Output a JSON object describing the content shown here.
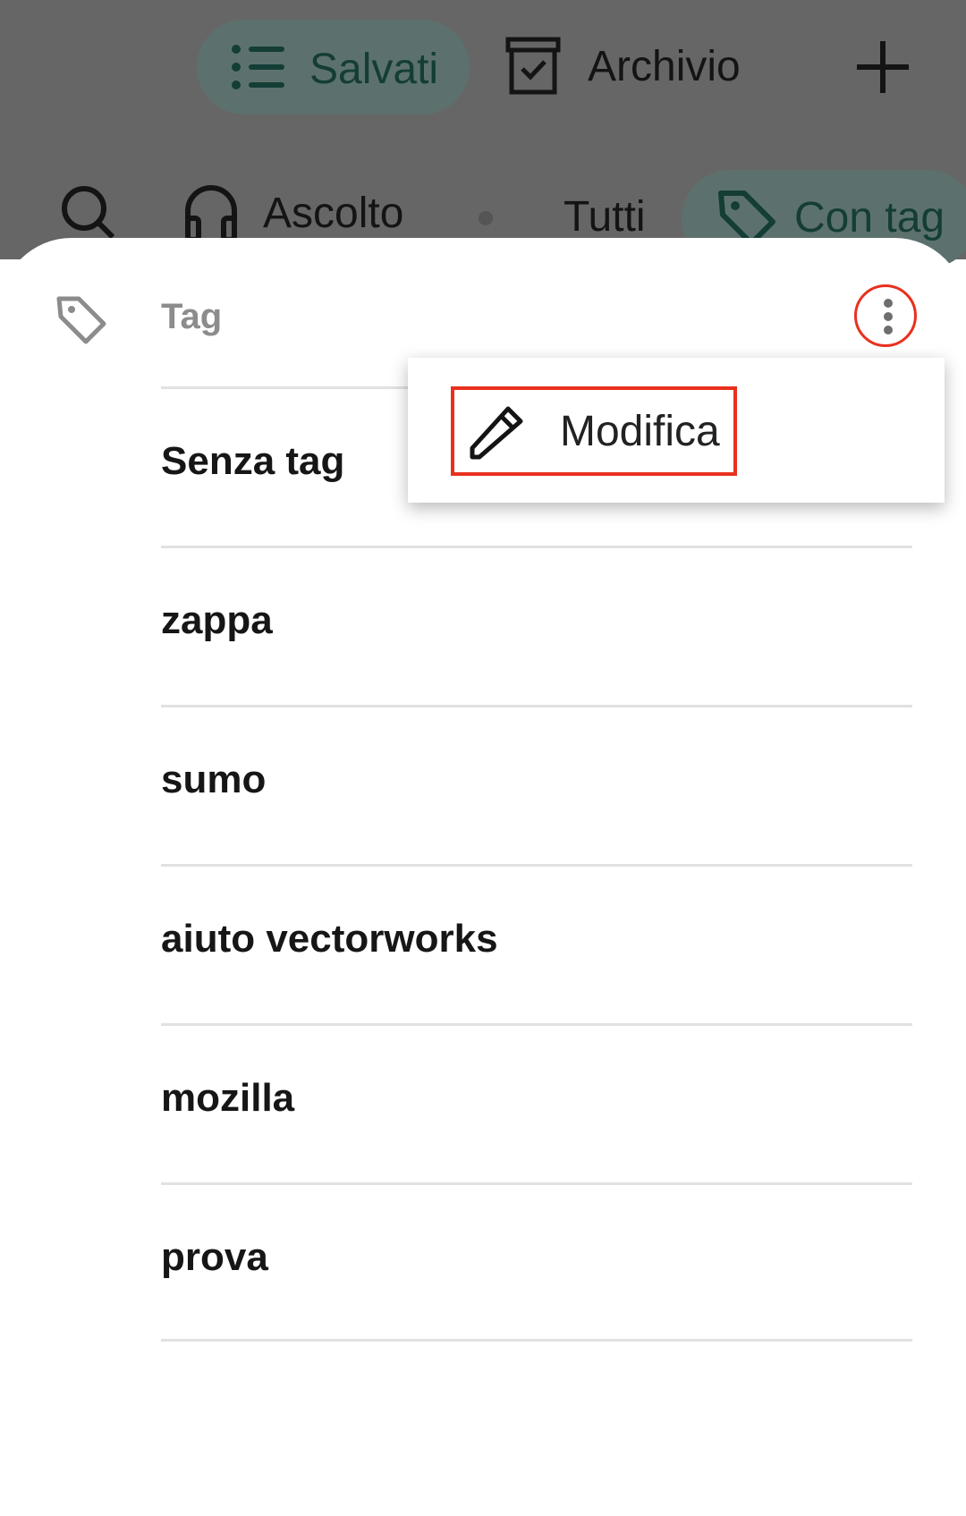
{
  "top_nav": {
    "saved_label": "Salvati",
    "archive_label": "Archivio"
  },
  "filters": {
    "listen_label": "Ascolto",
    "all_label": "Tutti",
    "tagged_label": "Con tag"
  },
  "sheet": {
    "title": "Tag",
    "items": [
      {
        "label": "Senza tag"
      },
      {
        "label": "zappa"
      },
      {
        "label": "sumo"
      },
      {
        "label": "aiuto vectorworks"
      },
      {
        "label": "mozilla"
      },
      {
        "label": "prova"
      }
    ]
  },
  "menu": {
    "edit_label": "Modifica"
  },
  "colors": {
    "accent": "#1f5a50",
    "highlight": "#e8311e",
    "scrim": "#666666"
  }
}
